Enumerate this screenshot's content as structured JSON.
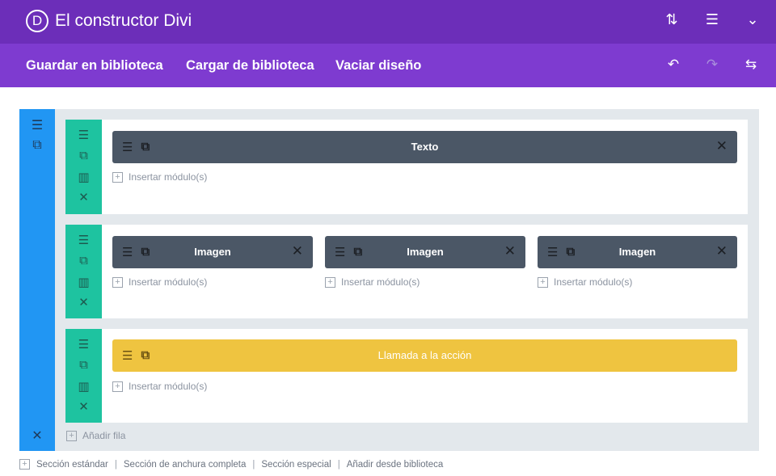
{
  "header": {
    "logo_letter": "D",
    "title": "El constructor Divi",
    "icons": [
      "sort-arrows-icon",
      "menu-icon",
      "chevron-down-icon"
    ]
  },
  "toolbar": {
    "save_label": "Guardar en biblioteca",
    "load_label": "Cargar de biblioteca",
    "clear_label": "Vaciar diseño",
    "icons": [
      "undo-icon",
      "redo-icon",
      "portability-icon"
    ]
  },
  "rows": [
    {
      "modules": [
        {
          "label": "Texto",
          "style": "dark"
        }
      ],
      "insert_labels": [
        "Insertar módulo(s)"
      ]
    },
    {
      "modules": [
        {
          "label": "Imagen",
          "style": "dark"
        },
        {
          "label": "Imagen",
          "style": "dark"
        },
        {
          "label": "Imagen",
          "style": "dark"
        }
      ],
      "insert_labels": [
        "Insertar módulo(s)",
        "Insertar módulo(s)",
        "Insertar módulo(s)"
      ]
    },
    {
      "modules": [
        {
          "label": "Llamada a la acción",
          "style": "yellow"
        }
      ],
      "insert_labels": [
        "Insertar módulo(s)"
      ]
    }
  ],
  "add_row_label": "Añadir fila",
  "footer": {
    "standard": "Sección estándar",
    "fullwidth": "Sección de anchura completa",
    "special": "Sección especial",
    "library": "Añadir desde biblioteca"
  },
  "colors": {
    "header": "#6c2eb9",
    "toolbar": "#7e3bd0",
    "section": "#2196f3",
    "row": "#1ec3a0",
    "module_dark": "#4b5766",
    "module_cta": "#efc440"
  }
}
